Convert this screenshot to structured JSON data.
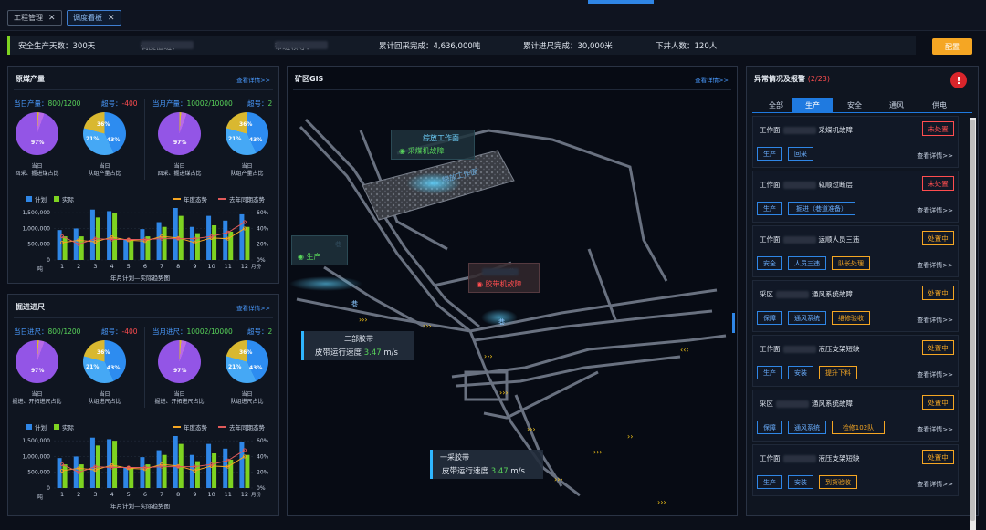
{
  "tabs": [
    {
      "label": "工程管理",
      "active": false
    },
    {
      "label": "调度看板",
      "active": true
    }
  ],
  "info": {
    "safe_days": "安全生产天数：300天",
    "dispatcher": "调度值班：",
    "leader": "带班领导：",
    "coal_total": "累计回采完成：4,636,000吨",
    "footage_total": "累计进尺完成：30,000米",
    "people": "下井人数：120人",
    "config_button": "配置"
  },
  "coal_panel": {
    "title": "原煤产量",
    "more": "查看详情>>",
    "daily_label": "当日产量：",
    "daily_value": "800/1200",
    "daily_over_label": "超号：",
    "daily_over": "-400",
    "monthly_label": "当月产量：",
    "monthly_value": "10002/10000",
    "monthly_over_label": "超号：",
    "monthly_over": "2",
    "pies": [
      {
        "pct": "97%",
        "cap1": "当日",
        "cap2": "回采、掘进煤占比"
      },
      {
        "pct_a": "36%",
        "pct_b": "21%",
        "pct_c": "43%",
        "cap1": "当日",
        "cap2": "队组产量占比"
      },
      {
        "pct": "97%",
        "cap1": "当日",
        "cap2": "回采、掘进煤占比"
      },
      {
        "pct_a": "36%",
        "pct_b": "21%",
        "pct_c": "43%",
        "cap1": "当日",
        "cap2": "队组产量占比"
      }
    ],
    "chart_caption": "年月计划—实际趋势图"
  },
  "tunnel_panel": {
    "title": "掘进进尺",
    "more": "查看详情>>",
    "daily_label": "当日进尺：",
    "daily_value": "800/1200",
    "daily_over_label": "超号：",
    "daily_over": "-400",
    "monthly_label": "当月进尺：",
    "monthly_value": "10002/10000",
    "monthly_over_label": "超号：",
    "monthly_over": "2",
    "pies": [
      {
        "pct": "97%",
        "cap1": "当日",
        "cap2": "掘进、开拓进尺占比"
      },
      {
        "pct_a": "36%",
        "pct_b": "21%",
        "pct_c": "43%",
        "cap1": "当日",
        "cap2": "队组进尺占比"
      },
      {
        "pct": "97%",
        "cap1": "当日",
        "cap2": "掘进、开拓进尺占比"
      },
      {
        "pct_a": "36%",
        "pct_b": "21%",
        "pct_c": "43%",
        "cap1": "当日",
        "cap2": "队组进尺占比"
      }
    ],
    "chart_caption": "年月计划—实际趋势图"
  },
  "chart_legend": {
    "plan": "计划",
    "actual": "实际",
    "year": "年度态势",
    "lastyear": "去年同期态势"
  },
  "chart_data": {
    "type": "bar",
    "categories": [
      "1",
      "2",
      "3",
      "4",
      "5",
      "6",
      "7",
      "8",
      "9",
      "10",
      "11",
      "12"
    ],
    "x_unit": "月份",
    "y_unit": "吨",
    "y_ticks": [
      "1,500,000",
      "1,000,000",
      "500,000",
      "0"
    ],
    "y2_ticks": [
      "60%",
      "40%",
      "20%",
      "0%"
    ],
    "ylim": [
      0,
      1500000
    ],
    "y2lim": [
      0,
      60
    ],
    "series": [
      {
        "name": "计划",
        "kind": "bar",
        "color": "#2f86e6",
        "values": [
          950000,
          1000000,
          1600000,
          1550000,
          650000,
          980000,
          1200000,
          1650000,
          1050000,
          1400000,
          1250000,
          1450000
        ]
      },
      {
        "name": "实际",
        "kind": "bar",
        "color": "#7ed321",
        "values": [
          750000,
          750000,
          1350000,
          1500000,
          650000,
          750000,
          1050000,
          1400000,
          850000,
          1100000,
          900000,
          1050000
        ]
      },
      {
        "name": "年度态势",
        "kind": "line",
        "color": "#f5a623",
        "values": [
          22,
          25,
          23,
          29,
          25,
          24,
          30,
          28,
          22,
          28,
          27,
          40
        ]
      },
      {
        "name": "去年同期态势",
        "kind": "line",
        "color": "#e05a5a",
        "values": [
          30,
          20,
          27,
          26,
          26,
          26,
          27,
          27,
          27,
          30,
          35,
          48
        ]
      }
    ]
  },
  "gis": {
    "title": "矿区GIS",
    "more": "查看详情>>",
    "labels": {
      "face_title": "综放工作面",
      "face_status": "采煤机故障",
      "face_inner": "综放工作面",
      "prod_status": "生产",
      "prod_tag": "巷",
      "fault_status": "胶带机故障",
      "fault_tag": "巷",
      "belt2_title": "二部胶带",
      "belt2_speed_label": "皮带运行速度",
      "belt2_speed": "3.47",
      "belt2_unit": "m/s",
      "belt1_title": "一采胶带",
      "belt1_speed_label": "皮带运行速度",
      "belt1_speed": "3.47",
      "belt1_unit": "m/s",
      "tag_a": "巷",
      "tag_b": "巷"
    }
  },
  "alerts": {
    "title": "异常情况及报警",
    "count": "(2/23)",
    "filters": [
      "全部",
      "生产",
      "安全",
      "通风",
      "供电"
    ],
    "active_filter": "生产",
    "detail": "查看详情>>",
    "items": [
      {
        "prefix": "工作面",
        "name": "采煤机故障",
        "status": "未处置",
        "status_type": "open",
        "tags": [
          {
            "t": "生产",
            "o": false
          },
          {
            "t": "回采",
            "o": false
          }
        ]
      },
      {
        "prefix": "工作面",
        "name": "轨顺过断层",
        "status": "未处置",
        "status_type": "open",
        "tags": [
          {
            "t": "生产",
            "o": false
          },
          {
            "t": "掘进（巷道准备）",
            "o": false
          }
        ]
      },
      {
        "prefix": "工作面",
        "name": "运顺人员三违",
        "status": "处置中",
        "status_type": "doing",
        "tags": [
          {
            "t": "安全",
            "o": false
          },
          {
            "t": "人员三违",
            "o": false
          },
          {
            "t": "队长处理",
            "o": true
          }
        ]
      },
      {
        "prefix": "采区",
        "name": "通风系统故障",
        "status": "处置中",
        "status_type": "doing",
        "tags": [
          {
            "t": "保障",
            "o": false
          },
          {
            "t": "通风系统",
            "o": false
          },
          {
            "t": "维修验收",
            "o": true
          }
        ]
      },
      {
        "prefix": "工作面",
        "name": "液压支架短缺",
        "status": "处置中",
        "status_type": "doing",
        "tags": [
          {
            "t": "生产",
            "o": false
          },
          {
            "t": "安装",
            "o": false
          },
          {
            "t": "提升下料",
            "o": true
          }
        ]
      },
      {
        "prefix": "采区",
        "name": "通风系统故障",
        "status": "处置中",
        "status_type": "doing",
        "tags": [
          {
            "t": "保障",
            "o": false
          },
          {
            "t": "通风系统",
            "o": false
          },
          {
            "t": "检修102队",
            "o": true
          }
        ]
      },
      {
        "prefix": "工作面",
        "name": "液压支架短缺",
        "status": "处置中",
        "status_type": "doing",
        "tags": [
          {
            "t": "生产",
            "o": false
          },
          {
            "t": "安装",
            "o": false
          },
          {
            "t": "到货验收",
            "o": true
          }
        ]
      }
    ]
  }
}
